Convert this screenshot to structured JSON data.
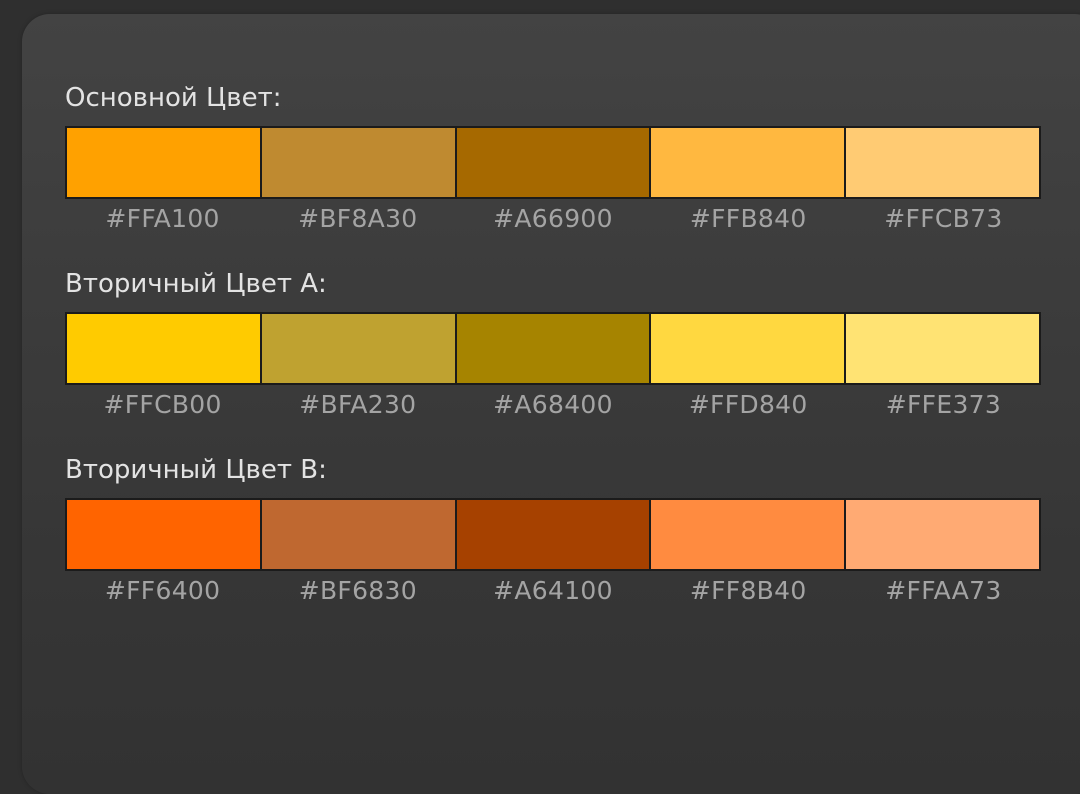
{
  "palettes": [
    {
      "title": "Основной Цвет:",
      "swatches": [
        {
          "hex": "#FFA100",
          "label": "#FFA100"
        },
        {
          "hex": "#BF8A30",
          "label": "#BF8A30"
        },
        {
          "hex": "#A66900",
          "label": "#A66900"
        },
        {
          "hex": "#FFB840",
          "label": "#FFB840"
        },
        {
          "hex": "#FFCB73",
          "label": "#FFCB73"
        }
      ]
    },
    {
      "title": "Вторичный Цвет А:",
      "swatches": [
        {
          "hex": "#FFCB00",
          "label": "#FFCB00"
        },
        {
          "hex": "#BFA230",
          "label": "#BFA230"
        },
        {
          "hex": "#A68400",
          "label": "#A68400"
        },
        {
          "hex": "#FFD840",
          "label": "#FFD840"
        },
        {
          "hex": "#FFE373",
          "label": "#FFE373"
        }
      ]
    },
    {
      "title": "Вторичный Цвет B:",
      "swatches": [
        {
          "hex": "#FF6400",
          "label": "#FF6400"
        },
        {
          "hex": "#BF6830",
          "label": "#BF6830"
        },
        {
          "hex": "#A64100",
          "label": "#A64100"
        },
        {
          "hex": "#FF8B40",
          "label": "#FF8B40"
        },
        {
          "hex": "#FFAA73",
          "label": "#FFAA73"
        }
      ]
    }
  ]
}
